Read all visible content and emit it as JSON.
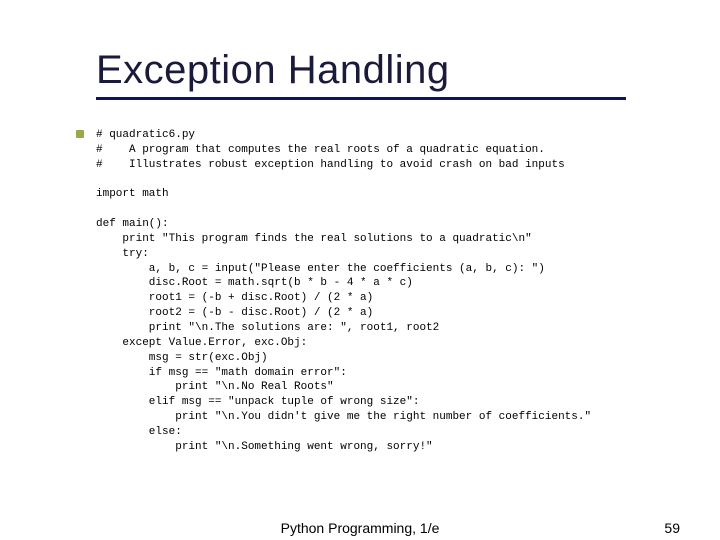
{
  "title": "Exception Handling",
  "code_lines": [
    "# quadratic6.py",
    "#    A program that computes the real roots of a quadratic equation.",
    "#    Illustrates robust exception handling to avoid crash on bad inputs",
    "",
    "import math",
    "",
    "def main():",
    "    print \"This program finds the real solutions to a quadratic\\n\"",
    "    try:",
    "        a, b, c = input(\"Please enter the coefficients (a, b, c): \")",
    "        disc.Root = math.sqrt(b * b - 4 * a * c)",
    "        root1 = (-b + disc.Root) / (2 * a)",
    "        root2 = (-b - disc.Root) / (2 * a)",
    "        print \"\\n.The solutions are: \", root1, root2",
    "    except Value.Error, exc.Obj:",
    "        msg = str(exc.Obj)",
    "        if msg == \"math domain error\":",
    "            print \"\\n.No Real Roots\"",
    "        elif msg == \"unpack tuple of wrong size\":",
    "            print \"\\n.You didn't give me the right number of coefficients.\"",
    "        else:",
    "            print \"\\n.Something went wrong, sorry!\""
  ],
  "footer": {
    "center": "Python Programming, 1/e",
    "page_number": "59"
  }
}
